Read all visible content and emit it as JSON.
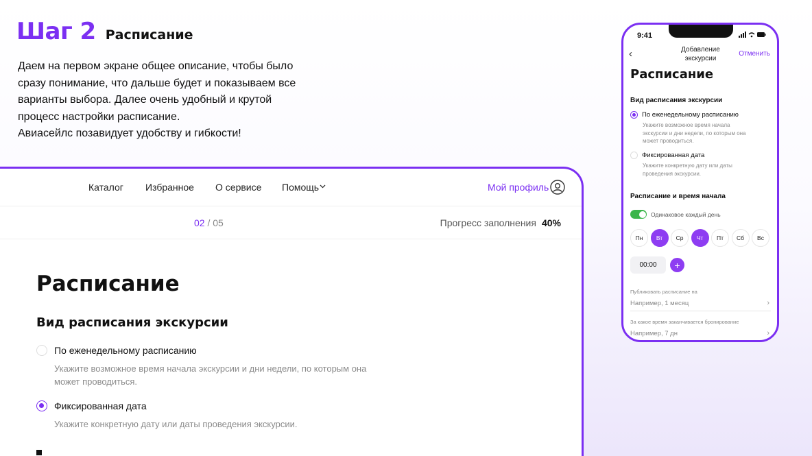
{
  "header": {
    "step": "Шаг 2",
    "title": "Расписание"
  },
  "description": [
    "Даем на первом экране общее описание, чтобы было",
    "сразу понимание, что дальше будет и показываем все",
    "варианты выбора. Далее очень удобный и крутой",
    "процесс настройки расписание.",
    "Авиасейлс позавидует удобству и гибкости!"
  ],
  "desktop": {
    "nav": {
      "catalog": "Каталог",
      "favorites": "Избранное",
      "about": "О сервисе",
      "help": "Помощь",
      "profile": "Мой профиль"
    },
    "progress": {
      "current": "02",
      "total": "/ 05",
      "label": "Прогресс заполнения",
      "value": "40%"
    },
    "title": "Расписание",
    "subtitle": "Вид расписания экскурсии",
    "options": [
      {
        "label": "По еженедельному расписанию",
        "hint_line1": "Укажите возможное время начала экскурсии и дни недели, по которым она",
        "hint_line2": "может проводиться.",
        "selected": false
      },
      {
        "label": "Фиксированная дата",
        "hint_line1": "Укажите конкретную дату или даты проведения экскурсии.",
        "selected": true
      }
    ]
  },
  "phone": {
    "time": "9:41",
    "header_line1": "Добавление",
    "header_line2": "экскурсии",
    "cancel": "Отменить",
    "title": "Расписание",
    "subtitle": "Вид расписания экскурсии",
    "options": [
      {
        "label": "По еженедельному расписанию",
        "hint_line1": "Укажите возможное время начала",
        "hint_line2": "экскурсии и дни недели, по которым она",
        "hint_line3": "может проводиться.",
        "selected": true
      },
      {
        "label": "Фиксированная дата",
        "hint_line1": "Укажите конкретную дату или даты",
        "hint_line2": "проведения экскурсии.",
        "selected": false
      }
    ],
    "schedule_title": "Расписание и время начала",
    "same_every_day": "Одинаковое каждый день",
    "days": [
      {
        "label": "Пн",
        "active": false
      },
      {
        "label": "Вт",
        "active": true
      },
      {
        "label": "Ср",
        "active": false
      },
      {
        "label": "Чт",
        "active": true
      },
      {
        "label": "Пт",
        "active": false
      },
      {
        "label": "Сб",
        "active": false
      },
      {
        "label": "Вс",
        "active": false
      }
    ],
    "start_time": "00:00",
    "add": "+",
    "publish_label": "Публиковать расписание на",
    "publish_placeholder": "Например, 1 месяц",
    "booking_label": "За какое  время заканчивается бронирование",
    "booking_placeholder": "Например, 7 дн"
  }
}
